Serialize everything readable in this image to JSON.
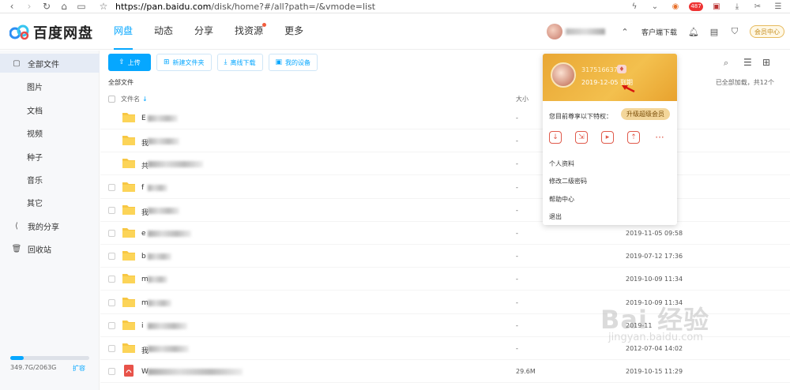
{
  "browser": {
    "url_prefix": "https://pan.baidu.com",
    "url_rest": "/disk/home?#/all?path=/&vmode=list",
    "badge_count": "487"
  },
  "header": {
    "logo_text": "百度网盘",
    "nav": [
      {
        "label": "网盘",
        "active": true
      },
      {
        "label": "动态",
        "active": false
      },
      {
        "label": "分享",
        "active": false
      },
      {
        "label": "找资源",
        "active": false,
        "dot": true
      },
      {
        "label": "更多",
        "active": false
      }
    ],
    "client_download": "客户端下载",
    "vip_center": "会员中心"
  },
  "sidebar": {
    "all_files": "全部文件",
    "items": [
      "图片",
      "文档",
      "视频",
      "种子",
      "音乐",
      "其它"
    ],
    "my_share": "我的分享",
    "recycle": "回收站",
    "storage_text": "349.7G/2063G",
    "storage_fraction": 0.17,
    "expand": "扩容"
  },
  "toolbar": {
    "upload": "上传",
    "new_folder": "新建文件夹",
    "offline_download": "离线下载",
    "my_devices": "我的设备"
  },
  "main": {
    "breadcrumb": "全部文件",
    "loaded_status": "已全部加载，共12个",
    "col_name": "文件名",
    "col_size": "大小"
  },
  "files": [
    {
      "name": "E",
      "size": "-",
      "date": ""
    },
    {
      "name": "我",
      "size": "-",
      "date": ""
    },
    {
      "name": "共",
      "size": "-",
      "date": ""
    },
    {
      "name": "f",
      "size": "-",
      "date": ""
    },
    {
      "name": "我",
      "size": "-",
      "date": ""
    },
    {
      "name": "e",
      "size": "-",
      "date": "2019-11-05 09:58"
    },
    {
      "name": "b",
      "size": "-",
      "date": "2019-07-12 17:36"
    },
    {
      "name": "m",
      "size": "-",
      "date": "2019-10-09 11:34"
    },
    {
      "name": "m",
      "size": "-",
      "date": "2019-10-09 11:34"
    },
    {
      "name": "i",
      "size": "-",
      "date": "2019-11"
    },
    {
      "name": "我",
      "size": "-",
      "date": "2012-07-04 14:02"
    },
    {
      "name": "W",
      "size": "29.6M",
      "date": "2019-10-15 11:29"
    }
  ],
  "popup": {
    "user_id": "317516637",
    "expire": "2019-12-05 到期",
    "privilege": "您目前尊享以下特权：",
    "upgrade": "升级超级会员",
    "menu": [
      "个人资料",
      "修改二级密码",
      "帮助中心",
      "退出"
    ]
  },
  "watermark": {
    "text": "Bai 经验",
    "url": "jingyan.baidu.com"
  }
}
